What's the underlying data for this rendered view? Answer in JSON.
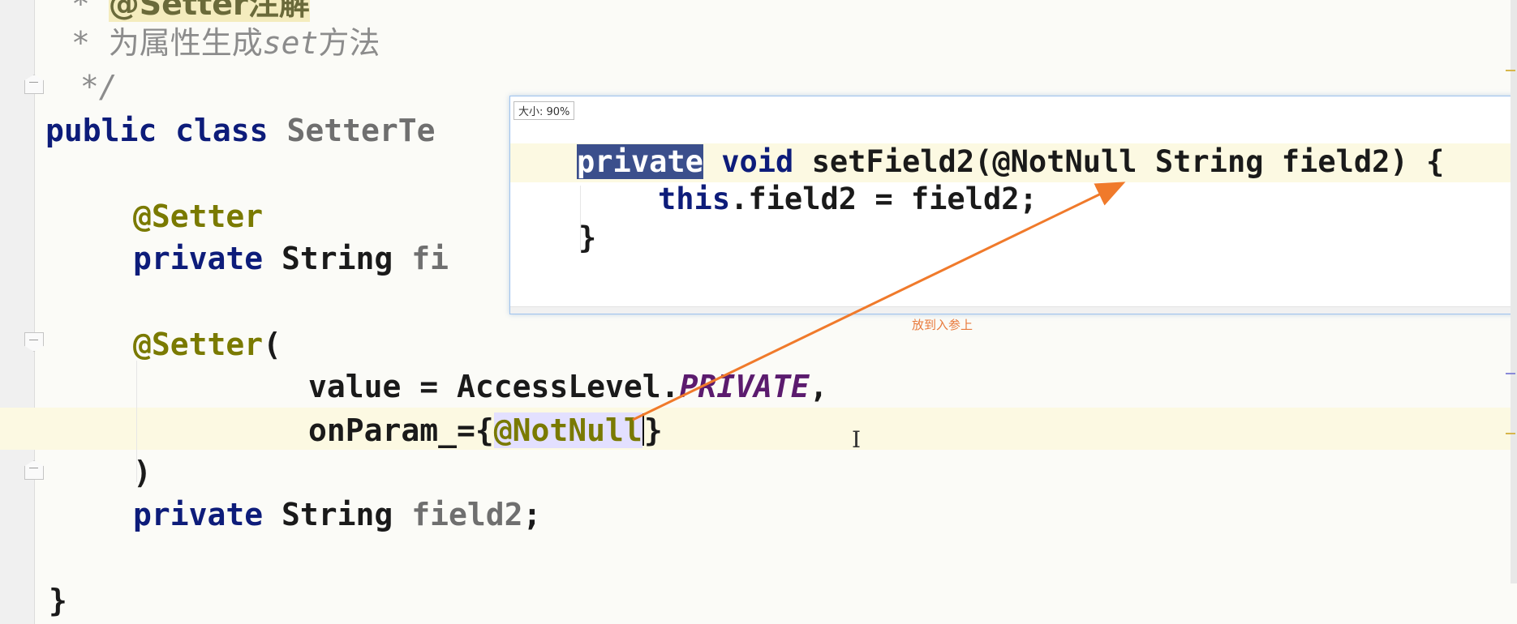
{
  "editor": {
    "comment_annotation": "@Setter注解",
    "comment_star": " * ",
    "comment_desc_1": "为属性生成",
    "comment_desc_set": "set",
    "comment_desc_2": "方法",
    "comment_end": " */",
    "line_class_kw1": "public",
    "line_class_kw2": "class",
    "line_class_name": "SetterTe",
    "ann_setter": "@Setter",
    "field1_private": "private",
    "field1_type": "String",
    "field1_name": "fi",
    "ann_setter2": "@Setter",
    "paren_open": "(",
    "value_key": "value = AccessLevel.",
    "value_const": "PRIVATE",
    "comma": ",",
    "onparam_key": "onParam_={",
    "onparam_ann": "@NotNull",
    "brace_close": "}",
    "paren_close": ")",
    "field2_private": "private",
    "field2_type": "String",
    "field2_name": "field2",
    "semicolon": ";",
    "class_close": "}"
  },
  "popup": {
    "size_label": "大小: 90%",
    "line1_kw": "private",
    "line1_rest_kw": "void",
    "line1_sig": "setField2(@NotNull String field2) {",
    "line2_this": "this",
    "line2_rest": ".field2 = field2;",
    "line3": "}"
  },
  "annotation_note": "放到入参上",
  "colors": {
    "arrow": "#f07a2b",
    "selection": "#3b4f8c",
    "keyword": "#0d1c7a",
    "annotation": "#7a7a00"
  }
}
